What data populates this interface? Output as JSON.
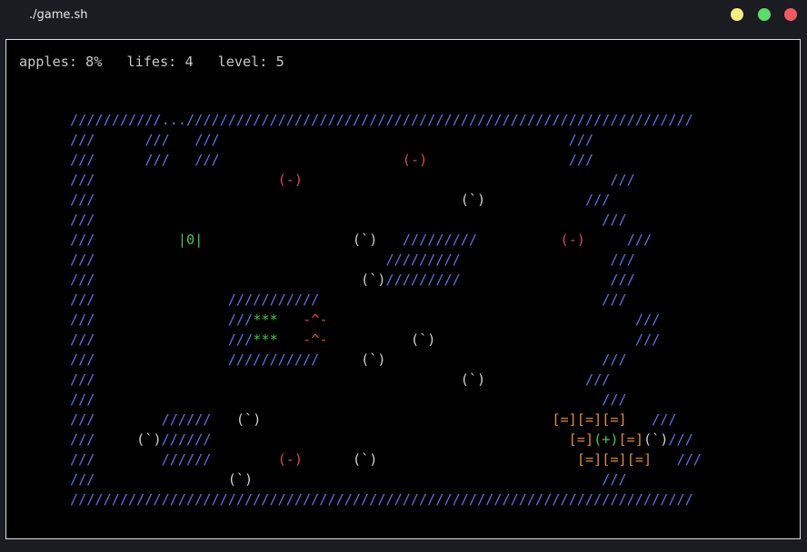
{
  "window": {
    "title": "./game.sh"
  },
  "status": {
    "apples": "apples: 8%",
    "lifes": "lifes: 4",
    "level": "level: 5"
  },
  "colors": {
    "wall": "#5f6fe8",
    "enemy": "#e04848",
    "apple": "#d0d0d0",
    "player": "#4fc24f",
    "food": "#3fc84a",
    "crate": "#e38b3a"
  },
  "board": {
    "rows": [
      [
        [
          "wall",
          "///////////"
        ],
        [
          "dots",
          "..."
        ],
        [
          "wall",
          "/////////////////////////////////////////////////////////////"
        ]
      ],
      [
        [
          "wall",
          "///"
        ],
        [
          "",
          "      "
        ],
        [
          "wall",
          "///"
        ],
        [
          "",
          "   "
        ],
        [
          "wall",
          "///"
        ],
        [
          "",
          "                                          "
        ],
        [
          "wall",
          "///"
        ]
      ],
      [
        [
          "wall",
          "///"
        ],
        [
          "",
          "      "
        ],
        [
          "wall",
          "///"
        ],
        [
          "",
          "   "
        ],
        [
          "wall",
          "///"
        ],
        [
          "",
          "                      "
        ],
        [
          "enemy",
          "(-)"
        ],
        [
          "",
          "                 "
        ],
        [
          "wall",
          "///"
        ]
      ],
      [
        [
          "wall",
          "///"
        ],
        [
          "",
          "                      "
        ],
        [
          "enemy",
          "(-)"
        ],
        [
          "",
          "                                     "
        ],
        [
          "wall",
          "///"
        ]
      ],
      [
        [
          "wall",
          "///"
        ],
        [
          "",
          "                                            "
        ],
        [
          "apple",
          "(`)"
        ],
        [
          "",
          "            "
        ],
        [
          "wall",
          "///"
        ]
      ],
      [
        [
          "wall",
          "///"
        ],
        [
          "",
          "                                                             "
        ],
        [
          "wall",
          "///"
        ]
      ],
      [
        [
          "wall",
          "///"
        ],
        [
          "",
          "          "
        ],
        [
          "player",
          "|0|"
        ],
        [
          "",
          "                  "
        ],
        [
          "apple",
          "(`)"
        ],
        [
          "",
          "   "
        ],
        [
          "wall",
          "/////////"
        ],
        [
          "",
          "          "
        ],
        [
          "enemy",
          "(-)"
        ],
        [
          "",
          "     "
        ],
        [
          "wall",
          "///"
        ]
      ],
      [
        [
          "wall",
          "///"
        ],
        [
          "",
          "                                   "
        ],
        [
          "wall",
          "/////////"
        ],
        [
          "",
          "                  "
        ],
        [
          "wall",
          "///"
        ]
      ],
      [
        [
          "wall",
          "///"
        ],
        [
          "",
          "                                "
        ],
        [
          "apple",
          "(`)"
        ],
        [
          "wall",
          "/////////"
        ],
        [
          "",
          "                  "
        ],
        [
          "wall",
          "///"
        ]
      ],
      [
        [
          "wall",
          "///"
        ],
        [
          "",
          "                "
        ],
        [
          "wall",
          "///////////"
        ],
        [
          "",
          "                                  "
        ],
        [
          "wall",
          "///"
        ]
      ],
      [
        [
          "wall",
          "///"
        ],
        [
          "",
          "                "
        ],
        [
          "wall",
          "///"
        ],
        [
          "food",
          "***"
        ],
        [
          "",
          "   "
        ],
        [
          "enemy",
          "-^-"
        ],
        [
          "",
          "                                     "
        ],
        [
          "wall",
          "///"
        ]
      ],
      [
        [
          "wall",
          "///"
        ],
        [
          "",
          "                "
        ],
        [
          "wall",
          "///"
        ],
        [
          "food",
          "***"
        ],
        [
          "",
          "   "
        ],
        [
          "enemy",
          "-^-"
        ],
        [
          "",
          "          "
        ],
        [
          "apple",
          "(`)"
        ],
        [
          "",
          "                        "
        ],
        [
          "wall",
          "///"
        ]
      ],
      [
        [
          "wall",
          "///"
        ],
        [
          "",
          "                "
        ],
        [
          "wall",
          "///////////"
        ],
        [
          "",
          "     "
        ],
        [
          "apple",
          "(`)"
        ],
        [
          "",
          "                          "
        ],
        [
          "wall",
          "///"
        ]
      ],
      [
        [
          "wall",
          "///"
        ],
        [
          "",
          "                                            "
        ],
        [
          "apple",
          "(`)"
        ],
        [
          "",
          "            "
        ],
        [
          "wall",
          "///"
        ]
      ],
      [
        [
          "wall",
          "///"
        ],
        [
          "",
          "                                                             "
        ],
        [
          "wall",
          "///"
        ]
      ],
      [
        [
          "wall",
          "///"
        ],
        [
          "",
          "        "
        ],
        [
          "wall",
          "//////"
        ],
        [
          "",
          "   "
        ],
        [
          "apple",
          "(`)"
        ],
        [
          "",
          "                                   "
        ],
        [
          "crate",
          "[=][=][=]"
        ],
        [
          "",
          "   "
        ],
        [
          "wall",
          "///"
        ]
      ],
      [
        [
          "wall",
          "///"
        ],
        [
          "",
          "     "
        ],
        [
          "apple",
          "(`)"
        ],
        [
          "wall",
          "//////"
        ],
        [
          "",
          "                                           "
        ],
        [
          "crate",
          "[=]"
        ],
        [
          "bonus",
          "(+)"
        ],
        [
          "crate",
          "[=]"
        ],
        [
          "apple",
          "(`)"
        ],
        [
          "wall",
          "///"
        ]
      ],
      [
        [
          "wall",
          "///"
        ],
        [
          "",
          "        "
        ],
        [
          "wall",
          "//////"
        ],
        [
          "",
          "        "
        ],
        [
          "enemy",
          "(-)"
        ],
        [
          "",
          "      "
        ],
        [
          "apple",
          "(`)"
        ],
        [
          "",
          "                        "
        ],
        [
          "crate",
          "[=][=][=]"
        ],
        [
          "",
          "   "
        ],
        [
          "wall",
          "///"
        ]
      ],
      [
        [
          "wall",
          "///"
        ],
        [
          "",
          "                "
        ],
        [
          "apple",
          "(`)"
        ],
        [
          "",
          "                                          "
        ],
        [
          "wall",
          "///"
        ]
      ],
      [
        [
          "wall",
          "///////////////////////////////////////////////////////////////////////////"
        ]
      ]
    ]
  }
}
